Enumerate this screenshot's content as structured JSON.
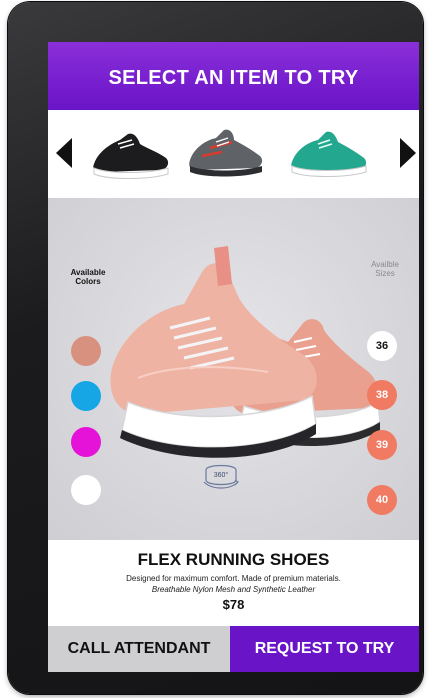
{
  "header": {
    "title": "SELECT AN ITEM TO TRY"
  },
  "carousel": {
    "items": [
      {
        "icon": "black-sneaker-icon",
        "color": "#1c1c1e"
      },
      {
        "icon": "gray-sneaker-icon",
        "color": "#5f6266"
      },
      {
        "icon": "teal-sneaker-icon",
        "color": "#23a78e"
      }
    ]
  },
  "product": {
    "colors_label": "Available Colors",
    "sizes_label": "Availble Sizes",
    "colors": [
      {
        "name": "salmon",
        "hex": "#d9917f"
      },
      {
        "name": "cyan",
        "hex": "#16a6e6"
      },
      {
        "name": "magenta",
        "hex": "#e512d8"
      },
      {
        "name": "white",
        "hex": "#ffffff"
      }
    ],
    "sizes": [
      {
        "label": "36",
        "selected": true
      },
      {
        "label": "38",
        "selected": false
      },
      {
        "label": "39",
        "selected": false
      },
      {
        "label": "40",
        "selected": false
      }
    ],
    "rotate_label": "360°",
    "name": "FLEX RUNNING SHOES",
    "description": "Designed for maximum comfort. Made of premium materials.",
    "material": "Breathable Nylon Mesh and Synthetic Leather",
    "price": "$78"
  },
  "actions": {
    "call_attendant": "CALL ATTENDANT",
    "request_to_try": "REQUEST TO TRY"
  },
  "theme": {
    "accent": "#6a14c8",
    "size_accent": "#f07a62"
  }
}
